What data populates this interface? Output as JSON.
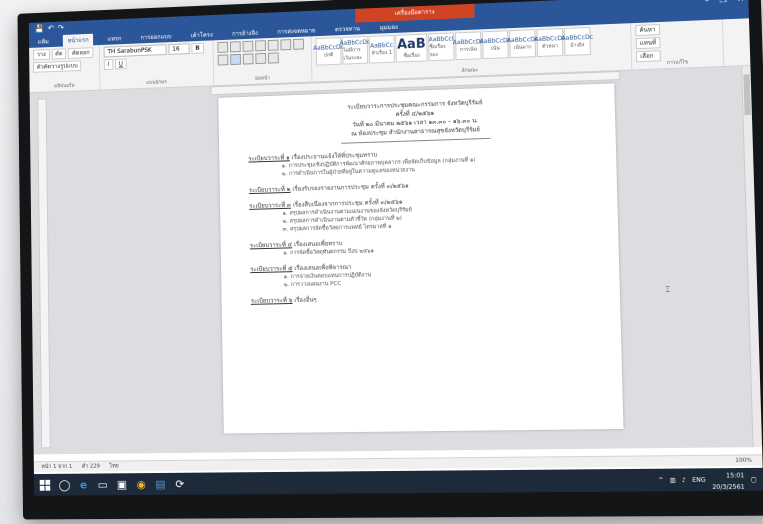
{
  "qat": {
    "save": "💾",
    "undo": "↶",
    "redo": "↷"
  },
  "context_tab": "เครื่องมือตาราง",
  "doc_title": "",
  "window_controls": {
    "minimize": "–",
    "restore": "❐",
    "close": "✕"
  },
  "tabs": [
    "แฟ้ม",
    "หน้าแรก",
    "แทรก",
    "การออกแบบ",
    "เค้าโครง",
    "การอ้างอิง",
    "การส่งจดหมาย",
    "ตรวจทาน",
    "มุมมอง"
  ],
  "ribbon": {
    "clipboard": {
      "paste": "วาง",
      "cut": "ตัด",
      "copy": "คัดลอก",
      "format_painter": "ตัวคัดวางรูปแบบ",
      "label": "คลิปบอร์ด"
    },
    "font": {
      "name": "TH SarabunPSK",
      "size": "16",
      "bold": "B",
      "italic": "I",
      "underline": "U",
      "label": "แบบอักษร"
    },
    "paragraph": {
      "label": "ย่อหน้า"
    },
    "styles": {
      "items": [
        {
          "preview": "AaBbCcDc",
          "name": "ปกติ"
        },
        {
          "preview": "AaBbCcDc",
          "name": "ไม่มีการเว้นระยะ"
        },
        {
          "preview": "AaBbCc",
          "name": "หัวเรื่อง 1"
        },
        {
          "preview": "AaB",
          "name": "ชื่อเรื่อง"
        },
        {
          "preview": "AaBbCcI",
          "name": "ชื่อเรื่องรอง"
        },
        {
          "preview": "AaBbCcDc",
          "name": "การเน้น"
        },
        {
          "preview": "AaBbCcDc",
          "name": "เน้น"
        },
        {
          "preview": "AaBbCcDc",
          "name": "เน้นมาก"
        },
        {
          "preview": "AaBbCcDc",
          "name": "ตัวหนา"
        },
        {
          "preview": "AaBbCcDc",
          "name": "อ้างอิง"
        }
      ],
      "label": "ลักษณะ"
    },
    "editing": {
      "find": "ค้นหา",
      "replace": "แทนที่",
      "select": "เลือก",
      "label": "การแก้ไข"
    }
  },
  "document": {
    "header": [
      "ระเบียบวาระการประชุมคณะกรรมการ จังหวัดบุรีรัมย์",
      "ครั้งที่ ๔/๒๕๖๑",
      "วันที่ ๒๐ มีนาคม ๒๕๖๑ เวลา ๑๓.๓๐ – ๑๖.๓๐ น.",
      "ณ ห้องประชุม สำนักงานสาธารณสุขจังหวัดบุรีรัมย์"
    ],
    "agenda": [
      {
        "label": "ระเบียบวาระที่ ๑",
        "title": "เรื่องประธานแจ้งให้ที่ประชุมทราบ",
        "items": [
          "๑. การประชุมเชิงปฏิบัติการพัฒนาศักยภาพบุคลากร เพื่อจัดเก็บข้อมูล (กลุ่มงานที่ ๑)",
          "๒. การดำเนินการในผู้ป่วยที่อยู่ในความดูแลของหน่วยงาน"
        ]
      },
      {
        "label": "ระเบียบวาระที่ ๒",
        "title": "เรื่องรับรองรายงานการประชุม ครั้งที่ ๓/๒๕๖๑",
        "items": []
      },
      {
        "label": "ระเบียบวาระที่ ๓",
        "title": "เรื่องสืบเนื่องจากการประชุม ครั้งที่ ๓/๒๕๖๑",
        "items": [
          "๑. สรุปผลการดำเนินงานตามแผนงานของจังหวัดบุรีรัมย์",
          "๒. สรุปผลการดำเนินงานตามตัวชี้วัด (กลุ่มงานที่ ๒)",
          "๓. สรุปผลการจัดซื้อวัสดุการแพทย์ ไตรมาสที่ ๑"
        ]
      },
      {
        "label": "ระเบียบวาระที่ ๔",
        "title": "เรื่องเสนอเพื่อทราบ",
        "items": [
          "๑. การจัดซื้อวัสดุทันตกรรม ปีงบ ๒๕๖๑"
        ]
      },
      {
        "label": "ระเบียบวาระที่ ๕",
        "title": "เรื่องเสนอเพื่อพิจารณา",
        "items": [
          "๑. การจ่ายเงินตอบแทนการปฏิบัติงาน",
          "๒. การวางแผนงาน PCC"
        ]
      },
      {
        "label": "ระเบียบวาระที่ ๖",
        "title": "เรื่องอื่นๆ",
        "items": []
      }
    ]
  },
  "statusbar": {
    "page": "หน้า 1 จาก 1",
    "words": "คำ 229",
    "lang": "ไทย",
    "zoom": "100%"
  },
  "taskbar": {
    "time": "15:01",
    "date": "20/3/2561",
    "lang": "ENG"
  }
}
